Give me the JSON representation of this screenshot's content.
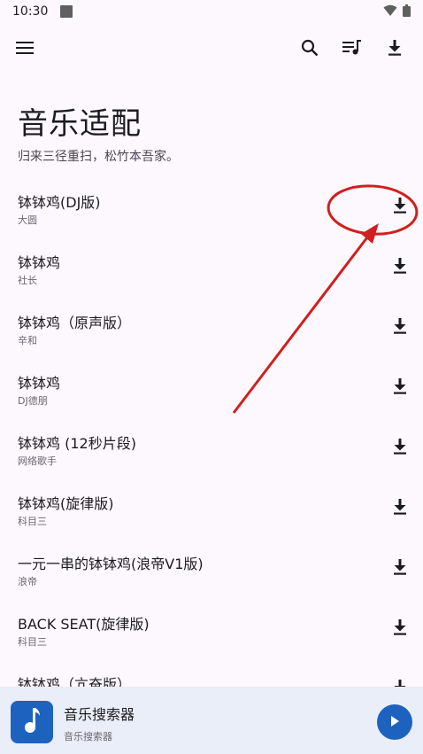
{
  "status": {
    "time": "10:30"
  },
  "header": {
    "title": "音乐适配",
    "subtitle": "归来三径重扫，松竹本吾家。"
  },
  "songs": [
    {
      "title": "钵钵鸡(DJ版)",
      "artist": "大圆"
    },
    {
      "title": "钵钵鸡",
      "artist": "社长"
    },
    {
      "title": "钵钵鸡（原声版）",
      "artist": "辛和"
    },
    {
      "title": "钵钵鸡",
      "artist": "DJ德朋"
    },
    {
      "title": "钵钵鸡 (12秒片段)",
      "artist": "网络歌手"
    },
    {
      "title": "钵钵鸡(旋律版)",
      "artist": "科目三"
    },
    {
      "title": "一元一串的钵钵鸡(浪帝V1版)",
      "artist": "浪帝"
    },
    {
      "title": "BACK SEAT(旋律版)",
      "artist": "科目三"
    },
    {
      "title": "钵钵鸡（亢奋版）",
      "artist": ""
    }
  ],
  "player": {
    "title": "音乐搜索器",
    "subtitle": "音乐搜索器"
  },
  "colors": {
    "background": "#fcf8fe",
    "accent": "#1d62bf",
    "player_bar": "#eaeef8",
    "annotation": "#d01f1f"
  },
  "icons": [
    "menu-icon",
    "search-icon",
    "queue-music-icon",
    "download-icon",
    "music-note-icon",
    "play-icon",
    "wifi-icon",
    "battery-icon"
  ]
}
